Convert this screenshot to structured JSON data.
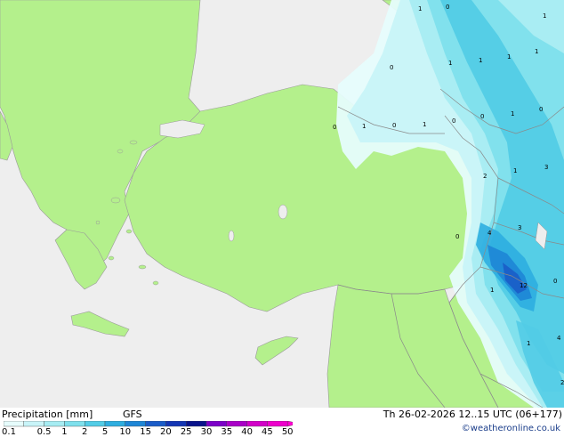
{
  "footer": {
    "title": "Precipitation [mm]",
    "model": "GFS",
    "valid": "Th 26-02-2026 12..15 UTC (06+177)",
    "credit": "©weatheronline.co.uk"
  },
  "legend": {
    "labels": [
      "0.1",
      "0.5",
      "1",
      "2",
      "5",
      "10",
      "15",
      "20",
      "25",
      "30",
      "35",
      "40",
      "45",
      "50"
    ],
    "colors": [
      "#e6fcfc",
      "#c8f4f8",
      "#a6ecf2",
      "#7ee0ec",
      "#52cce6",
      "#2eaee0",
      "#1e86d6",
      "#1a5cc8",
      "#1436b4",
      "#0a148c",
      "#7c00c8",
      "#aa00c8",
      "#d200c8",
      "#ee00cc",
      "#ff00d0"
    ]
  },
  "colors": {
    "land": "#b4f08c",
    "sea": "#eeeeee",
    "border": "#9a9a9a"
  },
  "map_labels": {
    "v1": "1",
    "v2": "0",
    "v3": "1",
    "v4": "0",
    "v5": "1",
    "v6": "1",
    "v7": "1",
    "v8": "0",
    "v9": "1",
    "v10": "0",
    "v11": "1",
    "v12": "0",
    "v13": "0",
    "v14": "1",
    "v15": "0",
    "v16": "1",
    "v17": "3",
    "v18": "2",
    "v19": "4",
    "v20": "3",
    "v21": "0",
    "v22": "1",
    "v23": "12",
    "v24": "0",
    "v25": "1",
    "v26": "4",
    "v27": "2"
  }
}
